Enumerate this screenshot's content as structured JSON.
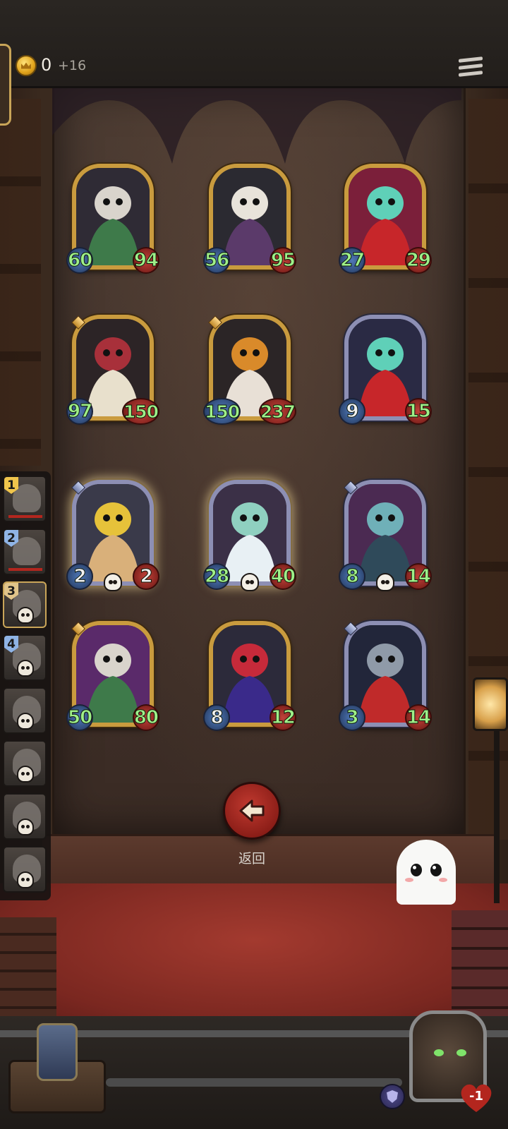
{
  "topbar": {
    "coins": "0",
    "coin_bonus": "+16"
  },
  "board": {
    "cards": [
      {
        "name": "reaper",
        "atk": "60",
        "hp": "94",
        "rarity": "gold",
        "gem": false,
        "skull": false,
        "glow": false,
        "stat_color": "green"
      },
      {
        "name": "skull-mage",
        "atk": "56",
        "hp": "95",
        "rarity": "gold",
        "gem": false,
        "skull": false,
        "glow": false,
        "stat_color": "green"
      },
      {
        "name": "spirit-summoner",
        "atk": "27",
        "hp": "29",
        "rarity": "gold",
        "gem": false,
        "skull": false,
        "glow": false,
        "stat_color": "green"
      },
      {
        "name": "harlequin-knight",
        "atk": "97",
        "hp": "150",
        "rarity": "gold",
        "gem": true,
        "skull": false,
        "glow": false,
        "stat_color": "green"
      },
      {
        "name": "pumpkin-golem",
        "atk": "150",
        "hp": "237",
        "rarity": "gold",
        "gem": true,
        "skull": false,
        "glow": false,
        "stat_color": "green"
      },
      {
        "name": "spirit-summoner-2",
        "atk": "9",
        "hp": "15",
        "rarity": "silver",
        "gem": false,
        "skull": false,
        "glow": false,
        "stat_color": "mixed"
      },
      {
        "name": "puppet-boy",
        "atk": "2",
        "hp": "2",
        "rarity": "silver",
        "gem": true,
        "skull": true,
        "glow": true,
        "stat_color": "white"
      },
      {
        "name": "moth-beast",
        "atk": "28",
        "hp": "40",
        "rarity": "silver",
        "gem": false,
        "skull": true,
        "glow": true,
        "stat_color": "green"
      },
      {
        "name": "stitched-rabbit",
        "atk": "8",
        "hp": "14",
        "rarity": "silver",
        "gem": true,
        "skull": true,
        "glow": false,
        "stat_color": "green"
      },
      {
        "name": "reaper-2",
        "atk": "50",
        "hp": "80",
        "rarity": "gold",
        "gem": true,
        "skull": false,
        "glow": false,
        "stat_color": "green"
      },
      {
        "name": "clown-jester",
        "atk": "8",
        "hp": "12",
        "rarity": "gold",
        "gem": false,
        "skull": false,
        "glow": false,
        "stat_color": "mixed"
      },
      {
        "name": "punk-rat",
        "atk": "3",
        "hp": "14",
        "rarity": "silver",
        "gem": true,
        "skull": false,
        "glow": false,
        "stat_color": "green"
      }
    ]
  },
  "timeline": {
    "slots": [
      {
        "num": "1",
        "badge": "gold",
        "bar": true,
        "skull": false
      },
      {
        "num": "2",
        "badge": "blue",
        "bar": true,
        "skull": false
      },
      {
        "num": "3",
        "badge": "tan",
        "bar": false,
        "skull": true
      },
      {
        "num": "4",
        "badge": "blue",
        "bar": false,
        "skull": true
      },
      {
        "num": "",
        "badge": "",
        "bar": false,
        "skull": true
      },
      {
        "num": "",
        "badge": "",
        "bar": false,
        "skull": true
      },
      {
        "num": "",
        "badge": "",
        "bar": false,
        "skull": true
      },
      {
        "num": "",
        "badge": "",
        "bar": false,
        "skull": true
      }
    ]
  },
  "back_button": {
    "label": "返回"
  },
  "hero": {
    "health": "-1"
  },
  "colors": {
    "stat_green": "#9ff089",
    "gold_frame": "#c99b3e",
    "silver_frame": "#8d8fb4",
    "button_red": "#b03026"
  }
}
